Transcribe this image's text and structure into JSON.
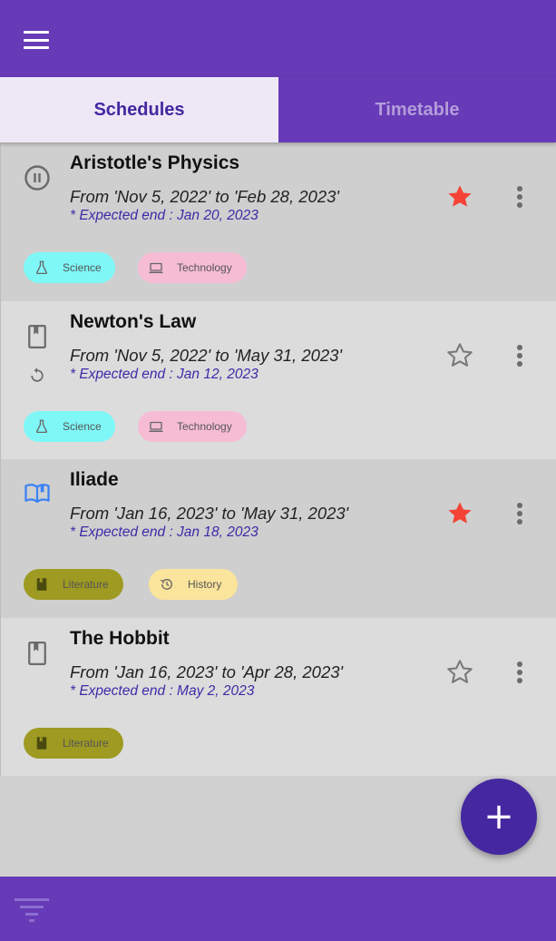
{
  "colors": {
    "primary": "#673ab7",
    "primary_dark": "#4527a0",
    "star_active": "#f44336",
    "expected_text": "#3f2aa8"
  },
  "appbar": {
    "menu_icon": "menu-icon"
  },
  "tabs": [
    {
      "label": "Schedules",
      "active": true
    },
    {
      "label": "Timetable",
      "active": false
    }
  ],
  "schedules": [
    {
      "title": "Aristotle's Physics",
      "dates": "From 'Nov 5, 2022' to 'Feb 28, 2023'",
      "expected": "* Expected end : Jan 20, 2023",
      "status_icon": "pause-circle-icon",
      "favorite": true,
      "tags": [
        {
          "label": "Science",
          "icon": "flask-icon"
        },
        {
          "label": "Technology",
          "icon": "laptop-icon"
        }
      ]
    },
    {
      "title": "Newton's Law",
      "dates": "From 'Nov 5, 2022' to 'May 31, 2023'",
      "expected": "* Expected end : Jan 12, 2023",
      "status_icon": "bookmark-book-icon",
      "secondary_icon": "repeat-icon",
      "favorite": false,
      "tags": [
        {
          "label": "Science",
          "icon": "flask-icon"
        },
        {
          "label": "Technology",
          "icon": "laptop-icon"
        }
      ]
    },
    {
      "title": "Iliade",
      "dates": "From 'Jan 16, 2023' to 'May 31, 2023'",
      "expected": "* Expected end : Jan 18, 2023",
      "status_icon": "open-book-icon",
      "favorite": true,
      "tags": [
        {
          "label": "Literature",
          "icon": "book-icon"
        },
        {
          "label": "History",
          "icon": "history-icon"
        }
      ]
    },
    {
      "title": "The Hobbit",
      "dates": "From 'Jan 16, 2023' to 'Apr 28, 2023'",
      "expected": "* Expected end : May 2, 2023",
      "status_icon": "bookmark-book-icon",
      "favorite": false,
      "tags": [
        {
          "label": "Literature",
          "icon": "book-icon"
        }
      ]
    }
  ],
  "fab": {
    "label": "+",
    "icon": "add-icon"
  },
  "bottombar": {
    "filter_icon": "filter-list-icon"
  }
}
